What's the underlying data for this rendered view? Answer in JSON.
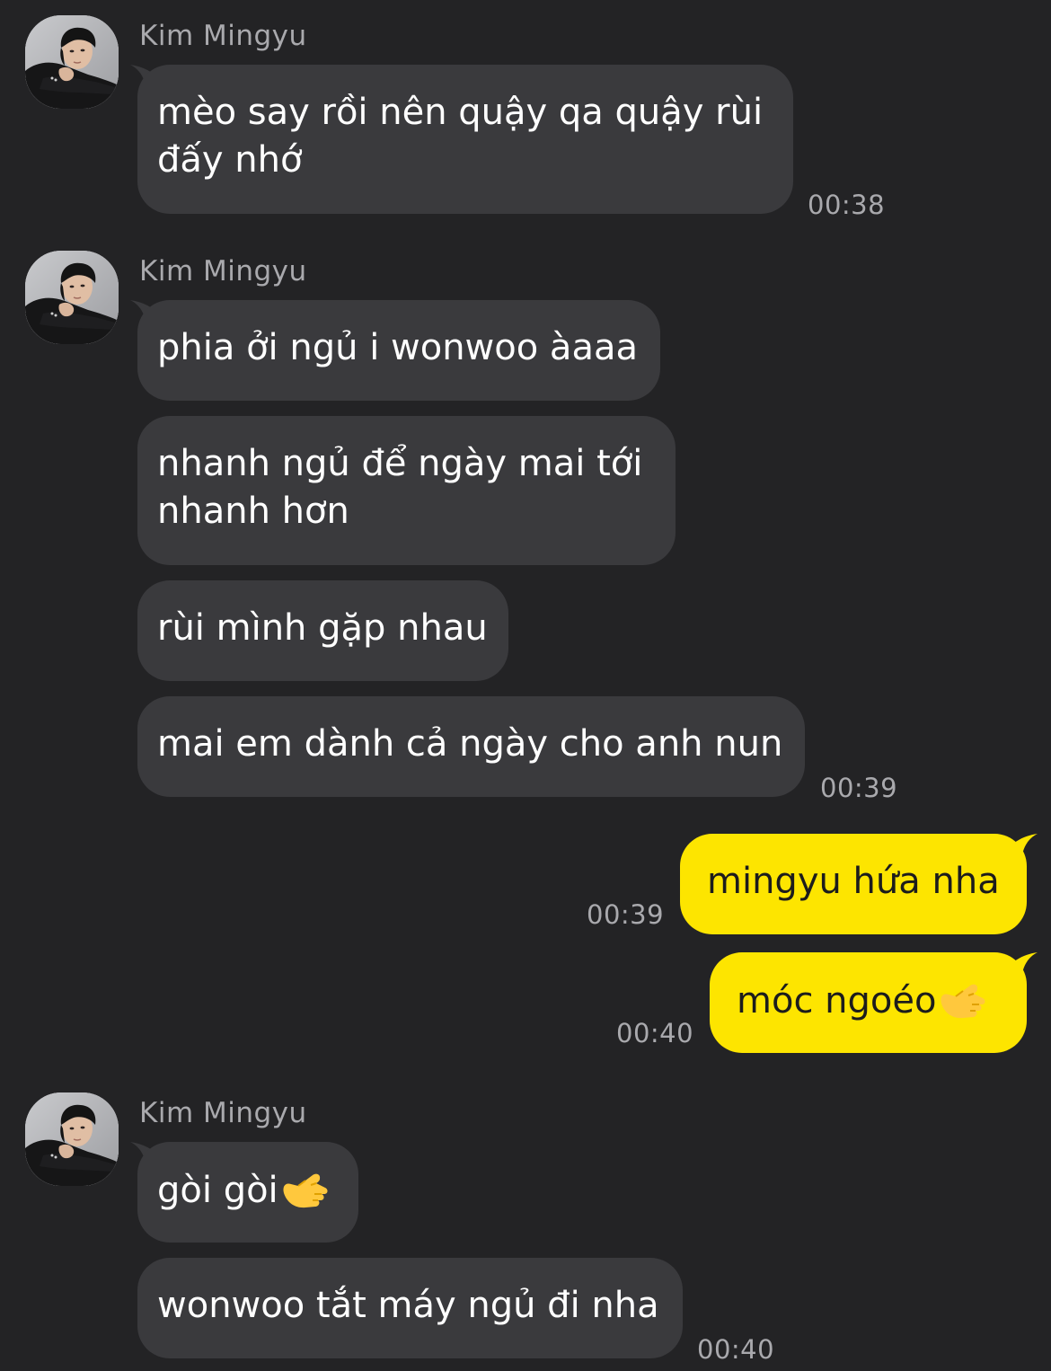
{
  "chat": {
    "messages": [
      {
        "sender": "Kim Mingyu",
        "text": "mèo say rồi nên quậy qa quậy rùi đấy nhớ",
        "time": "00:38"
      },
      {
        "sender": "Kim Mingyu",
        "text": "phia ởi ngủ i wonwoo àaaa"
      },
      {
        "text": "nhanh ngủ để ngày mai tới nhanh hơn"
      },
      {
        "text": "rùi mình gặp nhau"
      },
      {
        "text": "mai em dành cả ngày cho anh nun",
        "time": "00:39"
      },
      {
        "text": "mingyu hứa nha",
        "time": "00:39",
        "mine": true
      },
      {
        "text": "móc ngoéo",
        "emoji": "call-me-hand-emoji",
        "time": "00:40",
        "mine": true
      },
      {
        "sender": "Kim Mingyu",
        "text": "gòi gòi",
        "emoji": "call-me-hand-emoji"
      },
      {
        "text": "wonwoo tắt máy ngủ đi nha",
        "time": "00:40"
      }
    ]
  },
  "colors": {
    "background": "#232325",
    "incoming_bubble": "#3a3a3d",
    "outgoing_bubble": "#fde500",
    "meta_text": "#a9a9ad"
  }
}
